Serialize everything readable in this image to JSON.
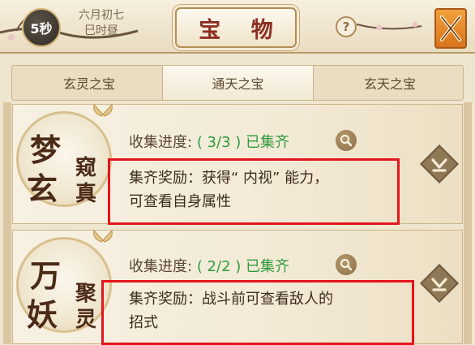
{
  "header": {
    "timer": "5秒",
    "date_line1": "六月初七",
    "date_line2": "巳时昼",
    "title": "宝 物",
    "help": "?"
  },
  "tabs": [
    {
      "label": "玄灵之宝",
      "active": false
    },
    {
      "label": "通天之宝",
      "active": true
    },
    {
      "label": "玄天之宝",
      "active": false
    }
  ],
  "cards": [
    {
      "emblem": {
        "big1": "梦",
        "big2": "玄",
        "small1": "窥",
        "small2": "真"
      },
      "progress_label": "收集进度:",
      "progress_value": "( 3/3 )",
      "progress_status": "已集齐",
      "reward_line1": "集齐奖励：获得“ 内视” 能力，",
      "reward_line2": "可查看自身属性"
    },
    {
      "emblem": {
        "big1": "万",
        "big2": "妖",
        "small1": "聚",
        "small2": "灵"
      },
      "progress_label": "收集进度:",
      "progress_value": "( 2/2 )",
      "progress_status": "已集齐",
      "reward_line1": "集齐奖励：战斗前可查看敌人的",
      "reward_line2": "招式"
    }
  ],
  "colors": {
    "title_red": "#8b2e22",
    "progress_green": "#2e9a3c",
    "highlight_red": "#e3141c",
    "close_orange": "#e08a2a"
  }
}
